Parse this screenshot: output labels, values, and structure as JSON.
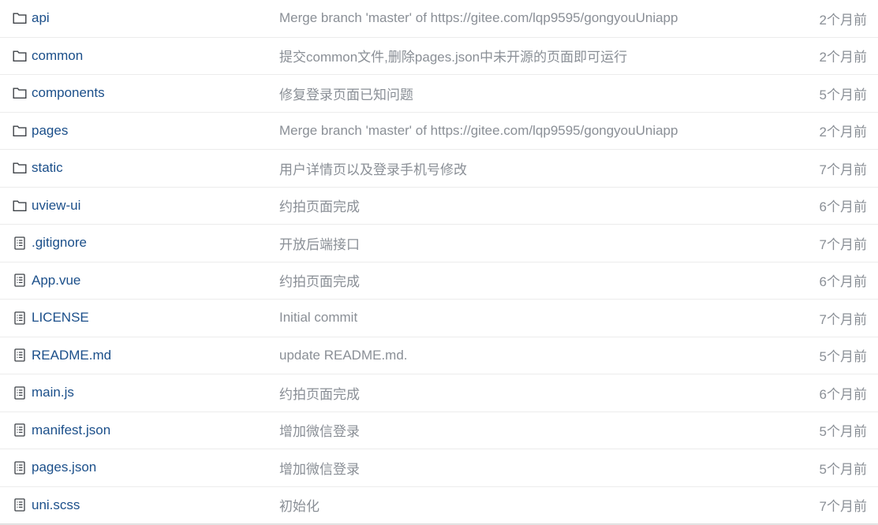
{
  "files": [
    {
      "type": "folder",
      "icon": "folder-icon",
      "name": "api",
      "commit": "Merge branch 'master' of https://gitee.com/lqp9595/gongyouUniapp",
      "time": "2个月前"
    },
    {
      "type": "folder",
      "icon": "folder-icon",
      "name": "common",
      "commit": "提交common文件,删除pages.json中未开源的页面即可运行",
      "time": "2个月前"
    },
    {
      "type": "folder",
      "icon": "folder-icon",
      "name": "components",
      "commit": "修复登录页面已知问题",
      "time": "5个月前"
    },
    {
      "type": "folder",
      "icon": "folder-icon",
      "name": "pages",
      "commit": "Merge branch 'master' of https://gitee.com/lqp9595/gongyouUniapp",
      "time": "2个月前"
    },
    {
      "type": "folder",
      "icon": "folder-icon",
      "name": "static",
      "commit": "用户详情页以及登录手机号修改",
      "time": "7个月前"
    },
    {
      "type": "folder",
      "icon": "folder-icon",
      "name": "uview-ui",
      "commit": "约拍页面完成",
      "time": "6个月前"
    },
    {
      "type": "file",
      "icon": "file-text-icon",
      "name": ".gitignore",
      "commit": "开放后端接口",
      "time": "7个月前"
    },
    {
      "type": "file",
      "icon": "file-text-icon",
      "name": "App.vue",
      "commit": "约拍页面完成",
      "time": "6个月前"
    },
    {
      "type": "file",
      "icon": "file-text-icon",
      "name": "LICENSE",
      "commit": "Initial commit",
      "time": "7个月前"
    },
    {
      "type": "file",
      "icon": "file-text-icon",
      "name": "README.md",
      "commit": "update README.md.",
      "time": "5个月前"
    },
    {
      "type": "file",
      "icon": "file-text-icon",
      "name": "main.js",
      "commit": "约拍页面完成",
      "time": "6个月前"
    },
    {
      "type": "file",
      "icon": "file-text-icon",
      "name": "manifest.json",
      "commit": "增加微信登录",
      "time": "5个月前"
    },
    {
      "type": "file",
      "icon": "file-text-icon",
      "name": "pages.json",
      "commit": "增加微信登录",
      "time": "5个月前"
    },
    {
      "type": "file",
      "icon": "file-text-icon",
      "name": "uni.scss",
      "commit": "初始化",
      "time": "7个月前"
    }
  ],
  "colors": {
    "link": "#1b4f8a",
    "muted": "#8a8f96",
    "divider": "#ececec",
    "icon": "#3c4046"
  }
}
